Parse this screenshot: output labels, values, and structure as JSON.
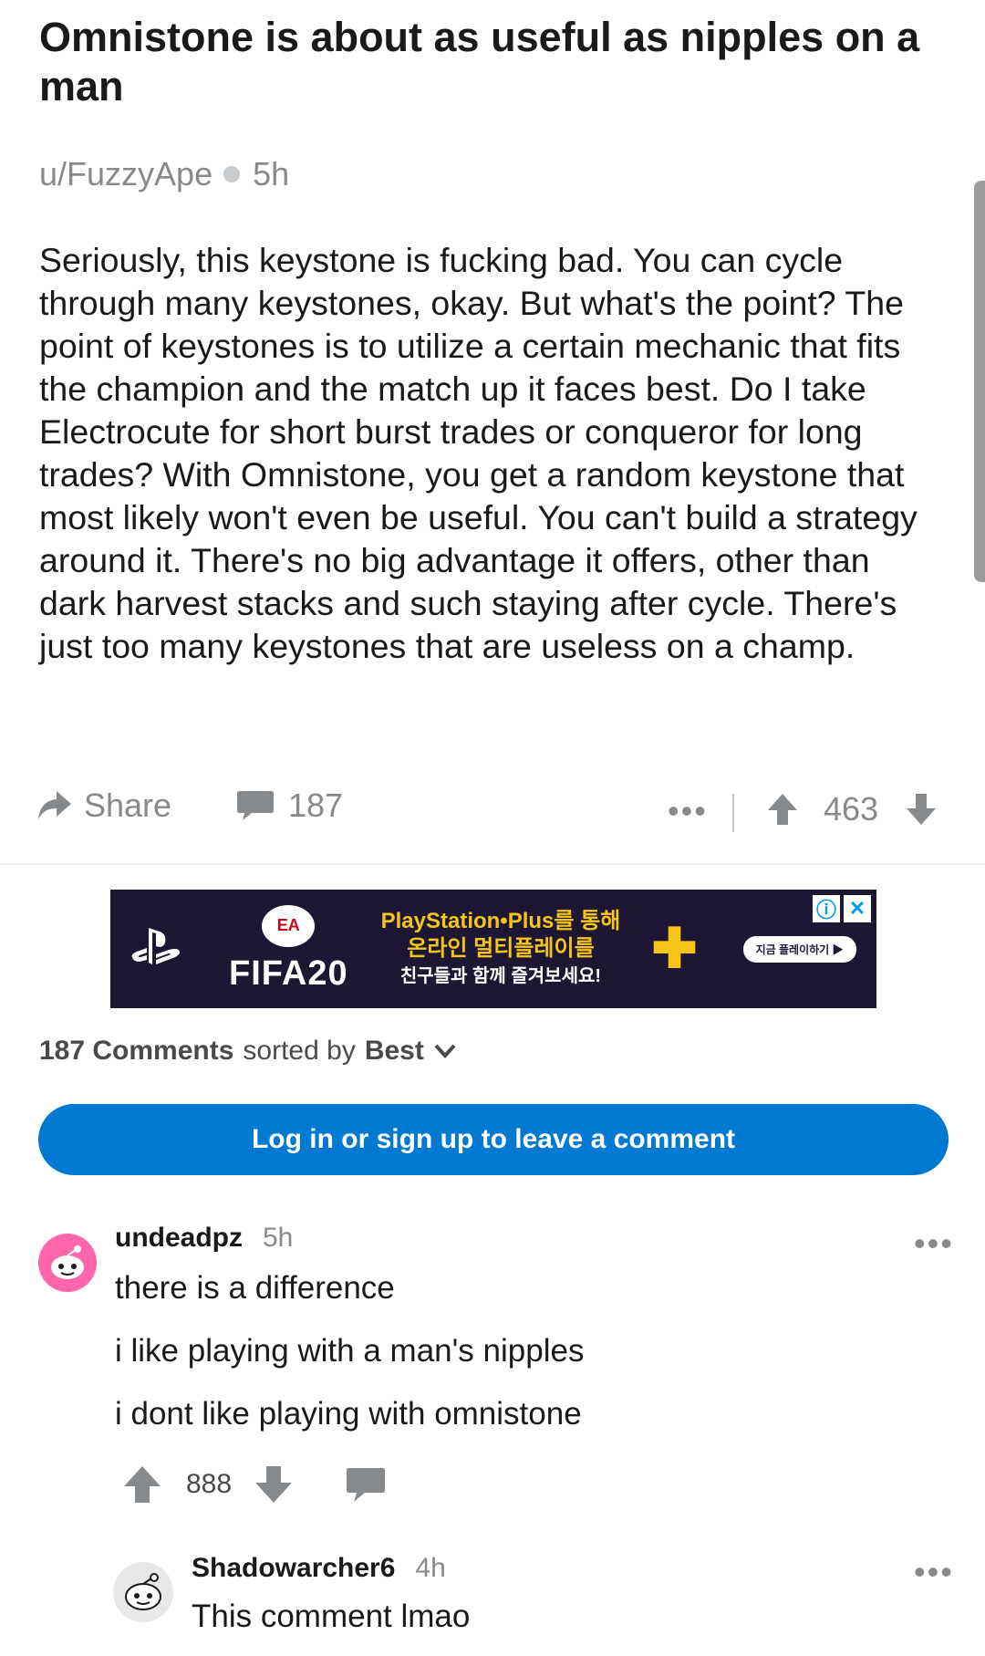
{
  "post": {
    "title": "Omnistone is about as useful as nipples on a man",
    "author": "u/FuzzyApe",
    "time": "5h",
    "body": "Seriously, this keystone is fucking bad. You can cycle through many keystones, okay. But what's the point? The point of keystones is to utilize a certain mechanic that fits the champion and the match up it faces best. Do I take Electrocute for short burst trades or conqueror for long trades? With Omnistone, you get a random keystone that most likely won't even be useful. You can't build a strategy around it. There's no big advantage it offers, other than dark harvest stacks and such staying after cycle. There's just too many keystones that are useless on a champ.",
    "share_label": "Share",
    "comment_count": "187",
    "vote_score": "463"
  },
  "ad": {
    "ea_label": "EA",
    "fifa_label": "FIFA20",
    "line1": "PlayStation•Plus를 통해",
    "line2": "온라인 멀티플레이를",
    "line3": "친구들과 함께 즐겨보세요!",
    "cta": "지금 플레이하기 ▶"
  },
  "comments_header": {
    "count_label": "187 Comments",
    "sorted_by": "sorted by",
    "sort_value": "Best"
  },
  "login_button": "Log in or sign up to leave a comment",
  "comments": [
    {
      "author": "undeadpz",
      "time": "5h",
      "lines": [
        "there is a difference",
        "i like playing with a man's nipples",
        "i dont like playing with omnistone"
      ],
      "score": "888"
    },
    {
      "author": "Shadowarcher6",
      "time": "4h",
      "lines": [
        "This comment lmao"
      ]
    }
  ],
  "colors": {
    "accent": "#0079d3",
    "meta_gray": "#878a8c",
    "ad_bg": "#1e1734",
    "ad_yellow": "#f5c518"
  },
  "icons": [
    "share-icon",
    "comment-bubble-icon",
    "more-icon",
    "upvote-icon",
    "downvote-icon",
    "chevron-down-icon",
    "snoo-avatar-icon",
    "reply-icon",
    "adchoices-icon",
    "close-icon",
    "playstation-logo-icon",
    "ps-plus-icon"
  ]
}
